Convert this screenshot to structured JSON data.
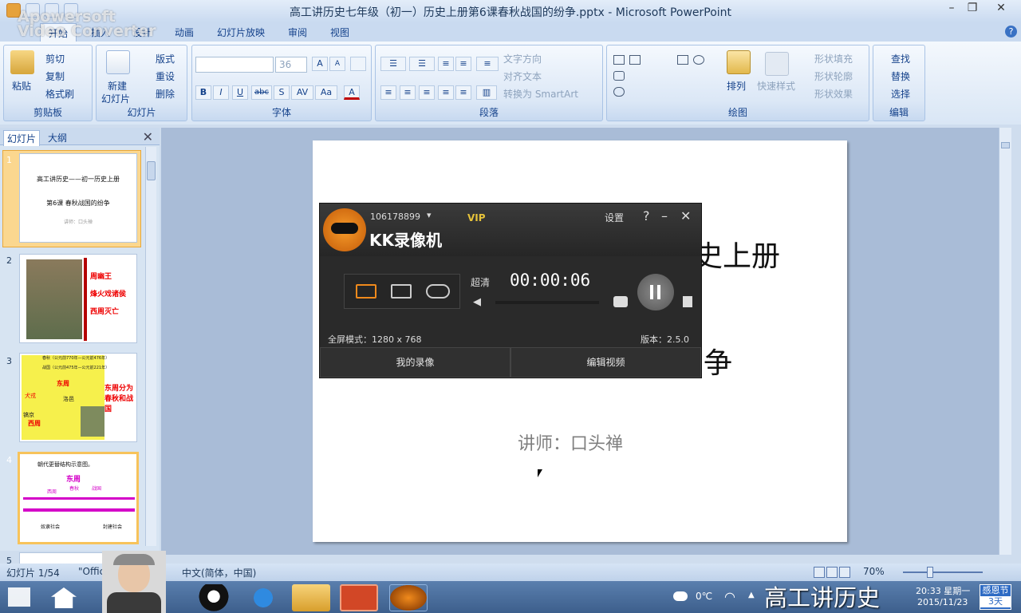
{
  "window": {
    "title": "高工讲历史七年级（初一）历史上册第6课春秋战国的纷争.pptx - Microsoft PowerPoint",
    "minimize": "–",
    "restore": "❐",
    "close": "✕"
  },
  "watermark": {
    "line1": "Apowersoft",
    "line2": "Video Converter"
  },
  "ribbon_tabs": [
    "开始",
    "插入",
    "设计",
    "动画",
    "幻灯片放映",
    "审阅",
    "视图"
  ],
  "help_glyph": "?",
  "ribbon": {
    "clipboard": {
      "label": "剪贴板",
      "paste": "粘贴",
      "cut": "剪切",
      "copy": "复制",
      "format_painter": "格式刷"
    },
    "slides": {
      "label": "幻灯片",
      "new_slide_line1": "新建",
      "new_slide_line2": "幻灯片",
      "layout": "版式",
      "reset": "重设",
      "delete": "删除"
    },
    "font": {
      "label": "字体",
      "size": "36",
      "grow": "A",
      "shrink": "A",
      "bold": "B",
      "italic": "I",
      "underline": "U",
      "strike": "abc",
      "shadow": "S",
      "spacing": "AV",
      "case": "Aa",
      "color": "A"
    },
    "paragraph": {
      "label": "段落",
      "text_direction": "文字方向",
      "align_text": "对齐文本",
      "smartart": "转换为 SmartArt"
    },
    "drawing": {
      "label": "绘图",
      "arrange": "排列",
      "quick_styles": "快速样式",
      "shape_fill": "形状填充",
      "shape_outline": "形状轮廓",
      "shape_effects": "形状效果"
    },
    "editing": {
      "label": "编辑",
      "find": "查找",
      "replace": "替换",
      "select": "选择"
    }
  },
  "left_pane": {
    "tab_slides": "幻灯片",
    "tab_outline": "大纲",
    "close": "✕",
    "thumbs": [
      {
        "num": "1",
        "title": "高工讲历史——初一历史上册",
        "subtitle": "第6课 春秋战国的纷争",
        "lecturer": "讲师：口头禅"
      },
      {
        "num": "2",
        "lines": [
          "周幽王",
          "烽火戏诸侯",
          "西周灭亡"
        ]
      },
      {
        "num": "3",
        "lines": [
          "春秋（公元前770年—公元前476年）",
          "战国（公元前475年—公元前221年）",
          "东周",
          "东周分为春秋和战国",
          "西周",
          "镐京",
          "洛邑",
          "犬戎"
        ]
      },
      {
        "num": "4",
        "lines": [
          "朝代更替结构示意图。",
          "东周",
          "春秋",
          "战国",
          "西周",
          "奴隶社会",
          "封建社会"
        ]
      },
      {
        "num": "5"
      }
    ]
  },
  "slide": {
    "title_fragment": "史上册",
    "subtitle_fragment": "争",
    "lecturer": "讲师：口头禅"
  },
  "kk_recorder": {
    "user_id": "106178899",
    "vip": "VIP",
    "settings": "设置",
    "help": "?",
    "minimize": "–",
    "close": "✕",
    "app_name": "KK录像机",
    "quality": "超清",
    "timer": "00:00:06",
    "mode": "全屏模式：1280 x 768",
    "version": "版本：2.5.0",
    "my_recordings": "我的录像",
    "edit_video": "编辑视频"
  },
  "status": {
    "slide_count": "幻灯片 1/54",
    "theme": "\"Offic",
    "language": "中文(简体，中国)",
    "zoom": "70%"
  },
  "taskbar": {
    "temperature": "0℃",
    "time": "20:33 星期一",
    "date": "2015/11/23",
    "festival": "感恩节",
    "days": "3天"
  },
  "caption": "高工讲历史"
}
